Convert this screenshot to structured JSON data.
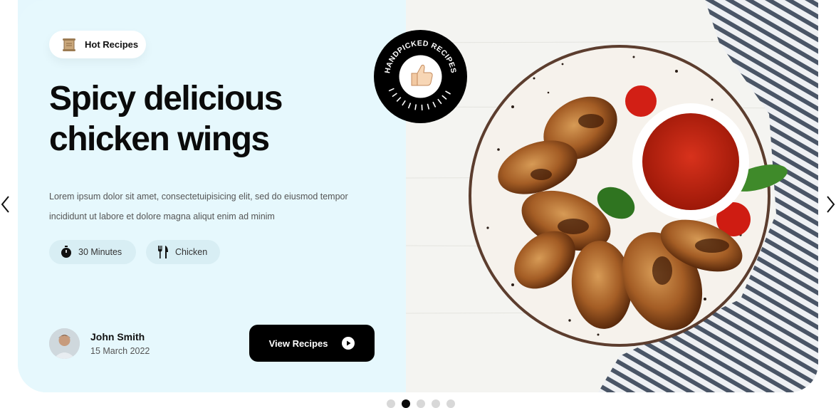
{
  "badge": {
    "label": "Hot Recipes",
    "icon": "scroll-icon"
  },
  "hero": {
    "title_line1": "Spicy delicious",
    "title_line2": "chicken wings",
    "description_line1": "Lorem ipsum dolor sit amet, consectetuipisicing elit, sed do eiusmod tempor",
    "description_line2": "incididunt ut labore et dolore magna aliqut enim ad minim"
  },
  "meta": {
    "time": {
      "label": "30 Minutes",
      "icon": "timer-icon"
    },
    "category": {
      "label": "Chicken",
      "icon": "fork-knife-icon"
    }
  },
  "author": {
    "name": "John Smith",
    "date": "15 March 2022"
  },
  "cta": {
    "label": "View Recipes",
    "icon": "play-icon"
  },
  "stamp": {
    "text": "HANDPICKED RECIPES",
    "icon": "thumbs-up-icon"
  },
  "carousel": {
    "slides": 5,
    "active_index": 1
  },
  "colors": {
    "panel": "#e6f8fd",
    "chip": "#d8eef4",
    "button": "#000000",
    "dot_inactive": "#d8d8d8",
    "dot_active": "#0b0b0b"
  }
}
